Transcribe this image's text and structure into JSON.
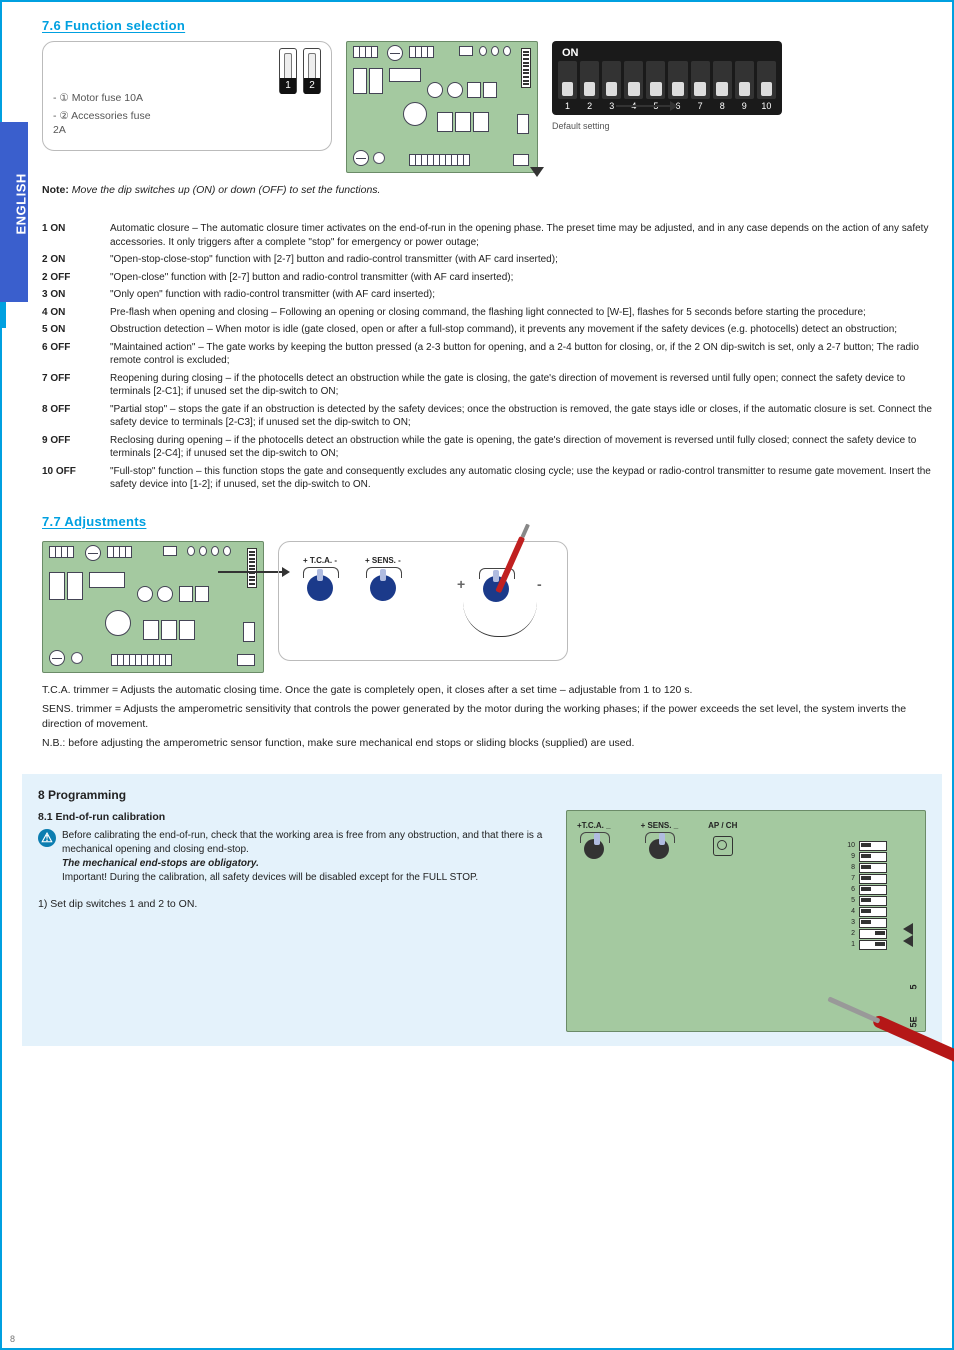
{
  "sidebar_label": "ENGLISH",
  "page_number": "8",
  "sec76": {
    "heading": "7.6 Function selection",
    "fuse": {
      "n1": "1",
      "n2": "2",
      "line1": "- ① Motor fuse 10A",
      "line2": "- ② Accessories fuse",
      "line3": "2A"
    },
    "dip": {
      "on": "ON",
      "nums": [
        "1",
        "2",
        "3",
        "4",
        "5",
        "6",
        "7",
        "8",
        "9",
        "10"
      ],
      "caption": "Default setting",
      "note_label": "Note:",
      "note": " Move the dip switches up (ON) or down (OFF) to set the functions."
    },
    "list": [
      {
        "lab": "1 ON",
        "desc": "Automatic closure – The automatic closure timer activates on the end-of-run in the opening phase. The preset time may be adjusted, and in any case depends on the action of any safety accessories. It only triggers after a complete \"stop\" for emergency or power outage;"
      },
      {
        "lab": "2 ON",
        "desc": "\"Open-stop-close-stop\" function with [2-7] button and radio-control transmitter (with AF card inserted);"
      },
      {
        "lab": "2 OFF",
        "desc": "\"Open-close\" function with [2-7] button and radio-control transmitter (with AF card inserted);"
      },
      {
        "lab": "3 ON",
        "desc": "\"Only open\" function with radio-control transmitter (with AF card inserted);"
      },
      {
        "lab": "4 ON",
        "desc": "Pre-flash when opening and closing – Following an opening or closing command, the flashing light connected to [W-E], flashes for 5 seconds before starting the procedure;"
      },
      {
        "lab": "5 ON",
        "desc": "Obstruction detection – When motor is idle (gate closed, open or after a full-stop command), it prevents any movement if the safety devices (e.g. photocells) detect an obstruction;"
      },
      {
        "lab": "6 OFF",
        "desc": "\"Maintained action\" – The gate works by keeping the button pressed (a 2-3 button for opening, and a 2-4 button for closing, or, if the 2 ON dip-switch is set, only a 2-7 button; The radio remote control is excluded;"
      },
      {
        "lab": "7 OFF",
        "desc": "Reopening during closing – if the photocells detect an obstruction while the gate is closing, the gate's direction of movement is reversed until fully open; connect the safety device to terminals [2-C1]; if unused set the dip-switch to ON;"
      },
      {
        "lab": "8 OFF",
        "desc": "\"Partial stop\" – stops the gate if an obstruction is detected by the safety devices; once the obstruction is removed, the gate stays idle or closes, if the automatic closure is set. Connect the safety device to terminals [2-C3]; if unused set the dip-switch to ON;"
      },
      {
        "lab": "9 OFF",
        "desc": "Reclosing during opening – if the photocells detect an obstruction while the gate is opening, the gate's direction of movement is reversed until fully closed; connect the safety device to terminals [2-C4]; if unused set the dip-switch to ON;"
      },
      {
        "lab": "10 OFF",
        "desc": "\"Full-stop\" function – this function stops the gate and consequently excludes any automatic closing cycle; use the keypad or radio-control transmitter to resume gate movement. Insert the safety device into [1-2]; if unused, set the dip-switch to ON."
      }
    ]
  },
  "sec77": {
    "heading": "7.7 Adjustments",
    "tca_label": "+ T.C.A. -",
    "sens_label": "+ SENS. -",
    "plus": "+",
    "minus": "-",
    "line_tca": "T.C.A. trimmer = Adjusts the automatic closing time. Once the gate is completely open, it closes after a set time – adjustable from 1 to 120 s.",
    "line_sens": "SENS. trimmer = Adjusts the amperometric sensitivity that controls the power generated by the motor during the working phases; if the power exceeds the set level, the system inverts the direction of movement.",
    "line_note": "N.B.: before adjusting the amperometric sensor function, make sure mechanical end stops or sliding blocks (supplied) are used."
  },
  "sec8": {
    "heading": "8 Programming",
    "sub81": "8.1 End-of-run calibration",
    "warn": "Before calibrating the end-of-run, check that the working area is free from any obstruction, and that there is a mechanical opening and closing end-stop.",
    "warn2": "The mechanical end-stops are obligatory.",
    "warn3": "Important! During the calibration, all safety devices will be disabled except for the FULL STOP.",
    "step1": "1) Set dip switches 1 and 2 to ON.",
    "corner": {
      "tca": "+T.C.A. _",
      "sens": "+ SENS. _",
      "apch": "AP / CH",
      "v1": "5",
      "v2": "5E",
      "dips": [
        "10",
        "9",
        "8",
        "7",
        "6",
        "5",
        "4",
        "3",
        "2",
        "1"
      ]
    }
  }
}
